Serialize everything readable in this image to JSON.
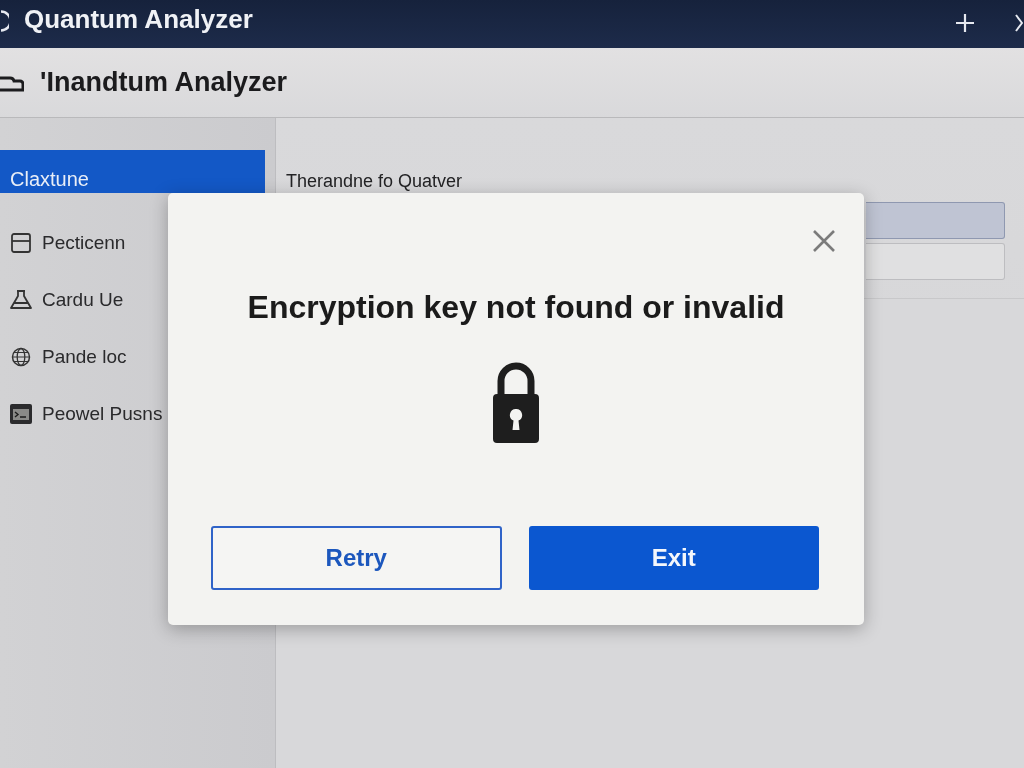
{
  "title_bar": {
    "title": "Quantum Analyzer"
  },
  "header": {
    "title": "'Inandtum Analyzer"
  },
  "sidebar": {
    "items": [
      {
        "label": "Claxtune",
        "selected": true
      },
      {
        "label": "Pecticenn",
        "selected": false
      },
      {
        "label": "Cardu Ue",
        "selected": false
      },
      {
        "label": "Pande loc",
        "selected": false
      },
      {
        "label": "Peowel Pusns",
        "selected": false
      }
    ]
  },
  "form": {
    "label": "Therandne fo Quatver",
    "fields": [
      {
        "focused": true
      },
      {
        "focused": false
      }
    ]
  },
  "dialog": {
    "message": "Encryption key not found or invalid",
    "buttons": [
      {
        "label": "Retry",
        "kind": "secondary"
      },
      {
        "label": "Exit",
        "kind": "primary"
      }
    ]
  }
}
